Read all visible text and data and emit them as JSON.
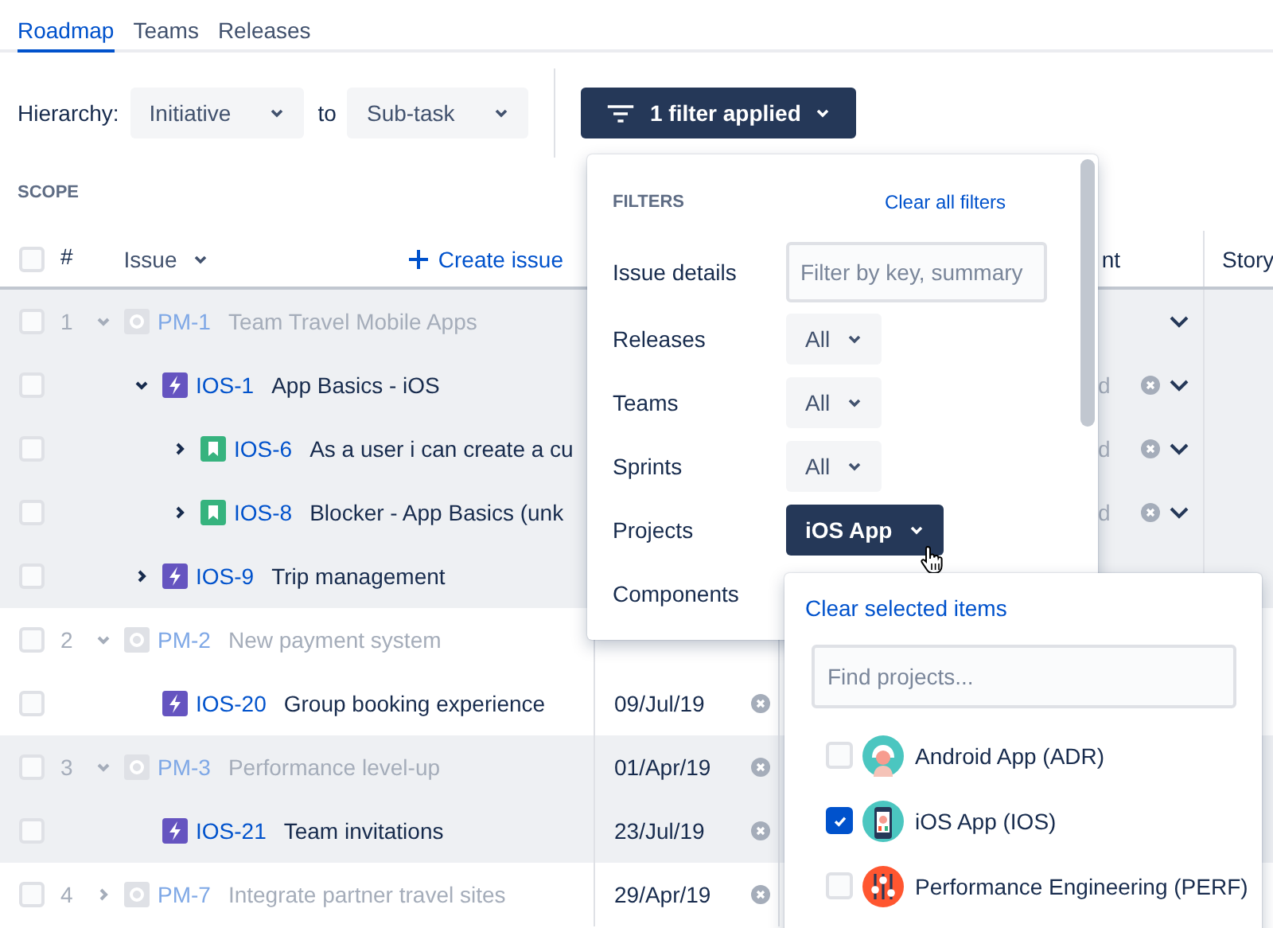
{
  "tabs": [
    {
      "label": "Roadmap",
      "selected": true
    },
    {
      "label": "Teams",
      "selected": false
    },
    {
      "label": "Releases",
      "selected": false
    }
  ],
  "toolbar": {
    "hierarchy_label": "Hierarchy:",
    "from": "Initiative",
    "connector": "to",
    "to": "Sub-task",
    "filter_button": "1 filter applied"
  },
  "scope_label": "SCOPE",
  "table": {
    "all_checked": false,
    "number_header": "#",
    "issue_header": "Issue",
    "create_issue": "Create issue",
    "column_3": "nt",
    "column_4": "Story",
    "rows": [
      {
        "number": "1",
        "kind": "initiative",
        "key": "PM-1",
        "summary": "Team Travel Mobile Apps",
        "checked": false,
        "dimmed": true,
        "shaded": true,
        "expanded": true,
        "menu_chevron": true,
        "children": [
          {
            "kind": "epic",
            "key": "IOS-1",
            "summary": "App Basics - iOS",
            "checked": false,
            "dimmed": false,
            "expanded": true,
            "column_3": "d",
            "clear_icon": true,
            "menu_chevron": true,
            "children": [
              {
                "kind": "story",
                "key": "IOS-6",
                "summary": "As a user i can create a cu",
                "checked": false,
                "dimmed": false,
                "expanded": false,
                "column_3": "d",
                "clear_icon": true,
                "menu_chevron": true
              },
              {
                "kind": "story",
                "key": "IOS-8",
                "summary": "Blocker - App Basics (unk",
                "checked": false,
                "dimmed": false,
                "expanded": false,
                "column_3": "d",
                "clear_icon": true,
                "menu_chevron": true
              }
            ]
          },
          {
            "kind": "epic",
            "key": "IOS-9",
            "summary": "Trip management",
            "checked": false,
            "dimmed": false,
            "expanded": false
          }
        ]
      },
      {
        "number": "2",
        "kind": "initiative",
        "key": "PM-2",
        "summary": "New payment system",
        "checked": false,
        "dimmed": true,
        "shaded": false,
        "expanded": true,
        "children": [
          {
            "kind": "epic",
            "key": "IOS-20",
            "summary": "Group booking experience",
            "checked": false,
            "dimmed": false,
            "date": "09/Jul/19",
            "clear_icon": true
          }
        ]
      },
      {
        "number": "3",
        "kind": "initiative",
        "key": "PM-3",
        "summary": "Performance level-up",
        "checked": false,
        "dimmed": true,
        "shaded": true,
        "expanded": true,
        "date": "01/Apr/19",
        "clear_icon": true,
        "children": [
          {
            "kind": "epic",
            "key": "IOS-21",
            "summary": "Team invitations",
            "checked": false,
            "dimmed": false,
            "date": "23/Jul/19",
            "clear_icon": true
          }
        ]
      },
      {
        "number": "4",
        "kind": "initiative",
        "key": "PM-7",
        "summary": "Integrate partner travel sites",
        "checked": false,
        "dimmed": true,
        "shaded": false,
        "expanded": false,
        "date": "29/Apr/19",
        "clear_icon": true
      }
    ]
  },
  "filter_panel": {
    "title": "FILTERS",
    "clear_all": "Clear all filters",
    "fields": [
      {
        "kind": "text",
        "label": "Issue details",
        "placeholder": "Filter by key, summary"
      },
      {
        "kind": "select",
        "label": "Releases",
        "value": "All",
        "active": false
      },
      {
        "kind": "select",
        "label": "Teams",
        "value": "All",
        "active": false
      },
      {
        "kind": "select",
        "label": "Sprints",
        "value": "All",
        "active": false
      },
      {
        "kind": "select",
        "label": "Projects",
        "value": "iOS App",
        "active": true
      },
      {
        "kind": "label",
        "label": "Components"
      }
    ]
  },
  "projects_dropdown": {
    "clear": "Clear selected items",
    "placeholder": "Find projects...",
    "options": [
      {
        "kind": "android",
        "label": "Android App (ADR)",
        "checked": false
      },
      {
        "kind": "ios",
        "label": "iOS App (IOS)",
        "checked": true
      },
      {
        "kind": "perf",
        "label": "Performance Engineering (PERF)",
        "checked": false
      }
    ]
  }
}
